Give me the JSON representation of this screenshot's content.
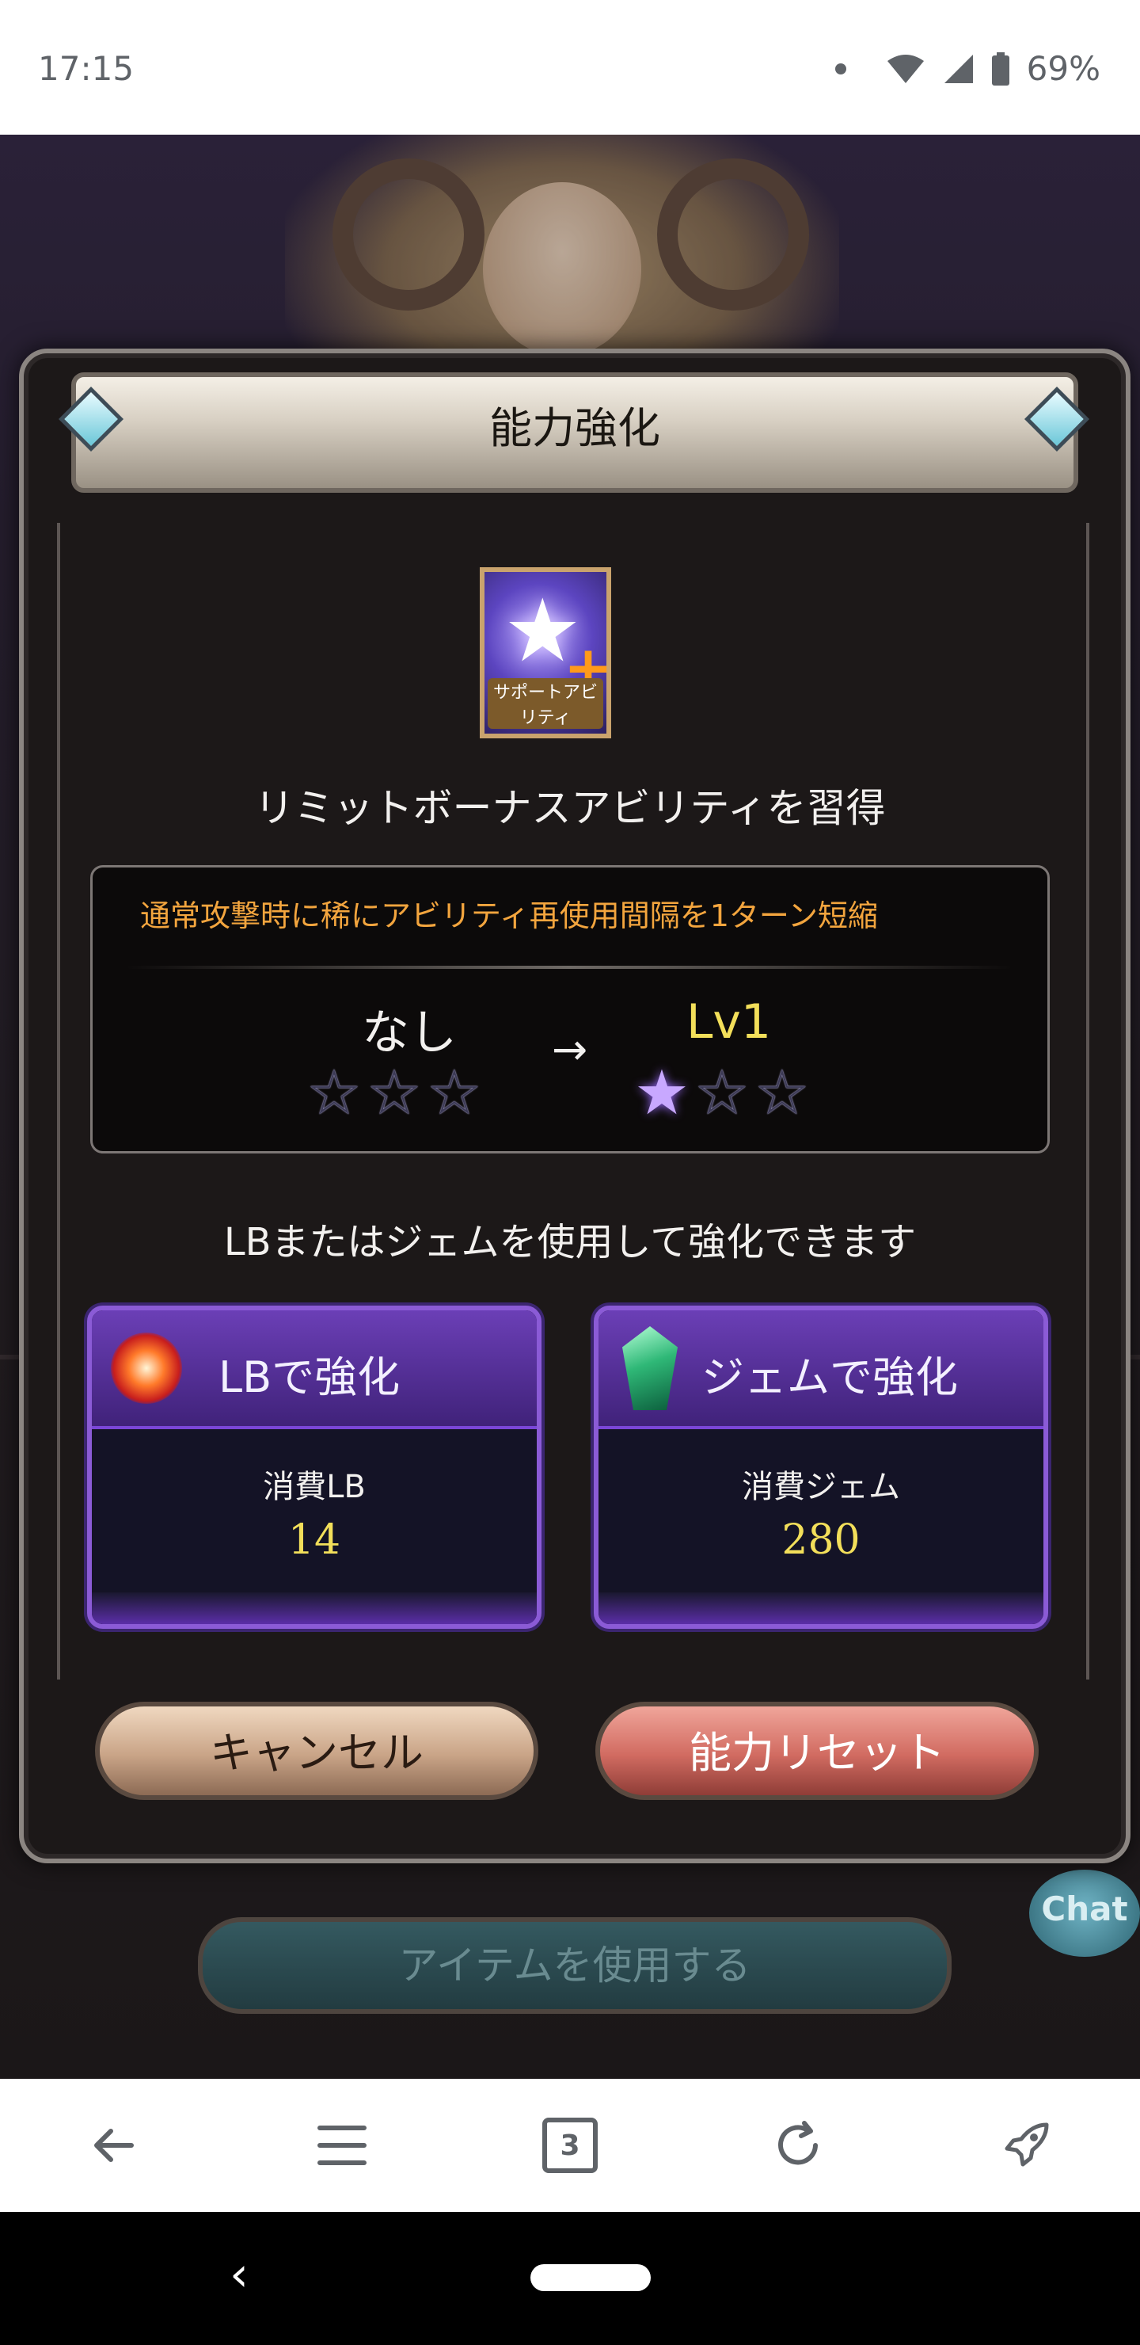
{
  "status_bar": {
    "time": "17:15",
    "battery": "69%"
  },
  "dialog": {
    "title": "能力強化",
    "ability_icon_tag": "サポートアビリティ",
    "acquire_text": "リミットボーナスアビリティを習得",
    "description": "通常攻撃時に稀にアビリティ再使用間隔を1ターン短縮",
    "level_from": "なし",
    "arrow": "→",
    "level_to": "Lv1",
    "stars_from": [
      "☆",
      "☆",
      "☆"
    ],
    "stars_to": [
      "★",
      "☆",
      "☆"
    ],
    "enhance_text": "LBまたはジェムを使用して強化できます",
    "lb_card": {
      "title": "LBで強化",
      "label": "消費LB",
      "value": "14"
    },
    "gem_card": {
      "title": "ジェムで強化",
      "label": "消費ジェム",
      "value": "280"
    },
    "cancel_label": "キャンセル",
    "reset_label": "能力リセット"
  },
  "background": {
    "item_button_label": "アイテムを使用する",
    "chat_label": "Chat"
  },
  "browser_toolbar": {
    "tab_count": "3",
    "icons": [
      "back-arrow-icon",
      "menu-icon",
      "tabs-icon",
      "refresh-icon",
      "rocket-icon"
    ]
  },
  "colors": {
    "accent_orange": "#f3a53e",
    "level_yellow": "#f3df5a",
    "card_purple": "#8b5bd6",
    "reset_red": "#d16b61"
  }
}
